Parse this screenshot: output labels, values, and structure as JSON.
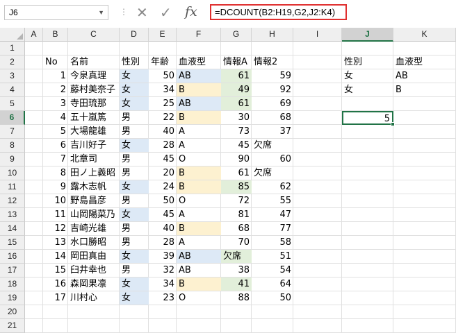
{
  "formula_bar": {
    "name_box": "J6",
    "cancel_glyph": "✕",
    "enter_glyph": "✓",
    "fx_label": "fx",
    "formula": "=DCOUNT(B2:H19,G2,J2:K4)"
  },
  "columns": [
    "A",
    "B",
    "C",
    "D",
    "E",
    "F",
    "G",
    "H",
    "I",
    "J",
    "K"
  ],
  "selected_column": "J",
  "rows": [
    "1",
    "2",
    "3",
    "4",
    "5",
    "6",
    "7",
    "8",
    "9",
    "10",
    "11",
    "12",
    "13",
    "14",
    "15",
    "16",
    "17",
    "18",
    "19",
    "20",
    "21"
  ],
  "selected_row": "6",
  "table": {
    "headers": [
      "No",
      "名前",
      "性別",
      "年齢",
      "血液型",
      "情報A",
      "情報2"
    ],
    "records": [
      [
        "1",
        "今泉真理",
        "女",
        "50",
        "AB",
        "61",
        "59"
      ],
      [
        "2",
        "藤村美奈子",
        "女",
        "34",
        "B",
        "49",
        "92"
      ],
      [
        "3",
        "寺田琉那",
        "女",
        "25",
        "AB",
        "61",
        "69"
      ],
      [
        "4",
        "五十嵐篤",
        "男",
        "22",
        "B",
        "30",
        "68"
      ],
      [
        "5",
        "大場龍雄",
        "男",
        "40",
        "A",
        "73",
        "37"
      ],
      [
        "6",
        "吉川好子",
        "女",
        "28",
        "A",
        "45",
        "欠席"
      ],
      [
        "7",
        "北章司",
        "男",
        "45",
        "O",
        "90",
        "60"
      ],
      [
        "8",
        "田ノ上義昭",
        "男",
        "20",
        "B",
        "61",
        "欠席"
      ],
      [
        "9",
        "露木志帆",
        "女",
        "24",
        "B",
        "85",
        "62"
      ],
      [
        "10",
        "野島昌彦",
        "男",
        "50",
        "O",
        "72",
        "55"
      ],
      [
        "11",
        "山岡陽菜乃",
        "女",
        "45",
        "A",
        "81",
        "47"
      ],
      [
        "12",
        "吉崎光雄",
        "男",
        "40",
        "B",
        "68",
        "77"
      ],
      [
        "13",
        "水口勝昭",
        "男",
        "28",
        "A",
        "70",
        "58"
      ],
      [
        "14",
        "岡田真由",
        "女",
        "39",
        "AB",
        "欠席",
        "51"
      ],
      [
        "15",
        "臼井幸也",
        "男",
        "32",
        "AB",
        "38",
        "54"
      ],
      [
        "16",
        "森岡果凛",
        "女",
        "34",
        "B",
        "41",
        "64"
      ],
      [
        "17",
        "川村心",
        "女",
        "23",
        "O",
        "88",
        "50"
      ]
    ]
  },
  "criteria": {
    "headers": [
      "性別",
      "血液型"
    ],
    "rows": [
      [
        "女",
        "AB"
      ],
      [
        "女",
        "B"
      ]
    ]
  },
  "result": {
    "cell": "J6",
    "value": "5"
  },
  "colors": {
    "blue_fill": "#dde9f6",
    "yellow_fill": "#fdf1d0",
    "green_fill": "#e2efda",
    "accent": "#217346",
    "formula_border": "#e03030"
  }
}
